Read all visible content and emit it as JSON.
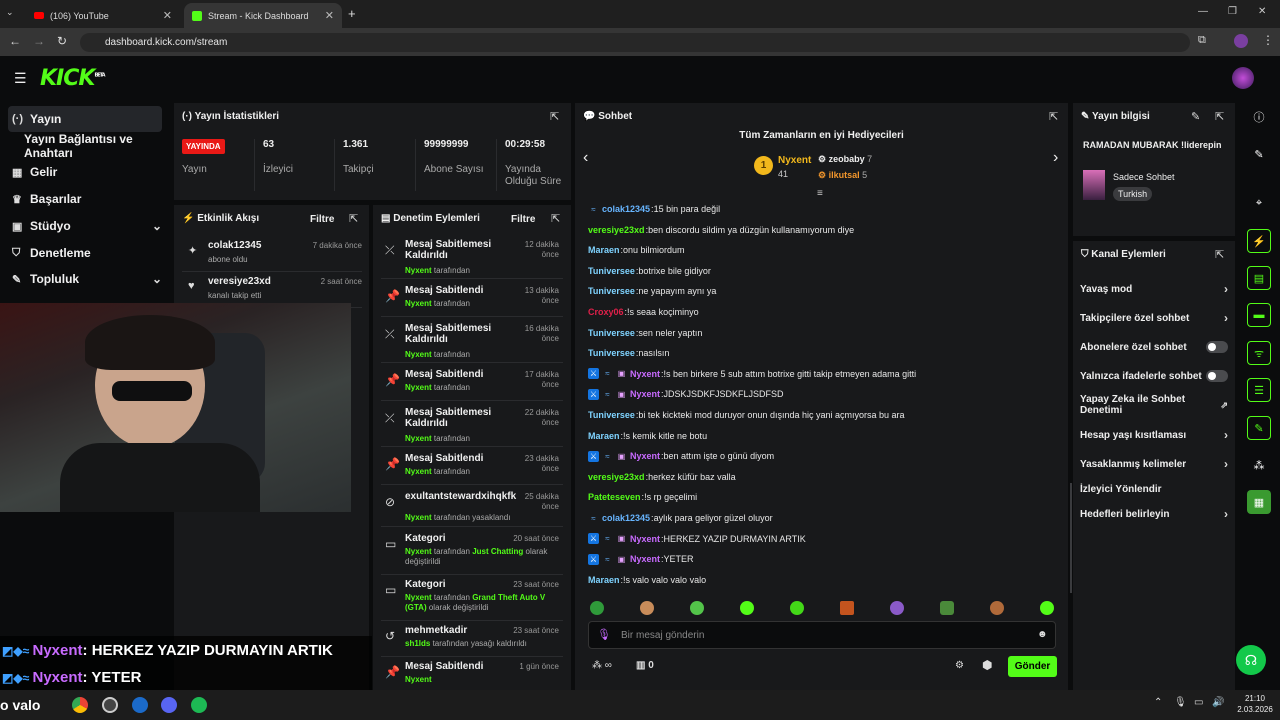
{
  "browser": {
    "tabs": [
      {
        "label": "(106) YouTube"
      },
      {
        "label": "Stream - Kick Dashboard"
      }
    ],
    "url": "dashboard.kick.com/stream"
  },
  "brand": {
    "logo": "KICK",
    "beta": "BETA"
  },
  "sidebar": {
    "items": [
      {
        "label": "Yayın"
      },
      {
        "label": "Yayın Bağlantısı ve Anahtarı"
      },
      {
        "label": "Gelir"
      },
      {
        "label": "Başarılar"
      },
      {
        "label": "Stüdyo"
      },
      {
        "label": "Denetleme"
      },
      {
        "label": "Topluluk"
      }
    ]
  },
  "stats": {
    "title": "Yayın İstatistikleri",
    "live": "YAYINDA",
    "live_label": "Yayın",
    "items": [
      {
        "value": "63",
        "label": "İzleyici"
      },
      {
        "value": "1.361",
        "label": "Takipçi"
      },
      {
        "value": "99999999",
        "label": "Abone Sayısı"
      },
      {
        "value": "00:29:58",
        "label": "Yayında Olduğu Süre"
      }
    ]
  },
  "activity": {
    "title": "Etkinlik Akışı",
    "filter": "Filtre",
    "events": [
      {
        "name": "colak12345",
        "sub": "abone oldu",
        "time": "7 dakika önce"
      },
      {
        "name": "veresiye23xd",
        "sub": "kanalı takip etti",
        "time": "2 saat önce"
      }
    ]
  },
  "modlog": {
    "title": "Denetim Eylemleri",
    "filter": "Filtre",
    "items": [
      {
        "title": "Mesaj Sabitlemesi Kaldırıldı",
        "user": "Nyxent",
        "rest": "tarafından",
        "time": "12 dakika önce"
      },
      {
        "title": "Mesaj Sabitlendi",
        "user": "Nyxent",
        "rest": "tarafından",
        "time": "13 dakika önce"
      },
      {
        "title": "Mesaj Sabitlemesi Kaldırıldı",
        "user": "Nyxent",
        "rest": "tarafından",
        "time": "16 dakika önce"
      },
      {
        "title": "Mesaj Sabitlendi",
        "user": "Nyxent",
        "rest": "tarafından",
        "time": "17 dakika önce"
      },
      {
        "title": "Mesaj Sabitlemesi Kaldırıldı",
        "user": "Nyxent",
        "rest": "tarafından",
        "time": "22 dakika önce"
      },
      {
        "title": "Mesaj Sabitlendi",
        "user": "Nyxent",
        "rest": "tarafından",
        "time": "23 dakika önce"
      },
      {
        "title": "exultantstewardxihqkfk",
        "user": "Nyxent",
        "rest": "tarafından yasaklandı",
        "time": "25 dakika önce"
      },
      {
        "title": "Kategori",
        "user": "Nyxent",
        "rest": "tarafından",
        "extra": "Just Chatting",
        "rest2": "olarak değiştirildi",
        "time": "20 saat önce"
      },
      {
        "title": "Kategori",
        "user": "Nyxent",
        "rest": "tarafından",
        "extra": "Grand Theft Auto V (GTA)",
        "rest2": "olarak değiştirildi",
        "time": "23 saat önce"
      },
      {
        "title": "mehmetkadir",
        "user": "sh1lds",
        "rest": "tarafından yasağı kaldırıldı",
        "time": "23 saat önce"
      },
      {
        "title": "Mesaj Sabitlendi",
        "user": "Nyxent",
        "rest": "",
        "time": "1 gün önce"
      }
    ]
  },
  "chat": {
    "title": "Sohbet",
    "top_title": "Tüm Zamanların en iyi Hediyecileri",
    "top": [
      {
        "rank": "1",
        "name": "Nyxent",
        "amount": "41"
      },
      {
        "name": "zeobaby",
        "amount": "7"
      },
      {
        "name": "ilkutsal",
        "amount": "5"
      }
    ],
    "messages": [
      {
        "user": "colak12345",
        "text": "15 bin para değil",
        "color": "#67b5ff",
        "badges": "v"
      },
      {
        "user": "veresiye23xd",
        "text": "ben discordu sildim ya düzgün kullanamıyorum diye",
        "color": "#53fc18",
        "badges": ""
      },
      {
        "user": "Maraen",
        "text": "onu bilmiordum",
        "color": "#7fd3ff",
        "badges": ""
      },
      {
        "user": "Tuniversee",
        "text": "botrixe bile gidiyor",
        "color": "#7fd3ff",
        "badges": ""
      },
      {
        "user": "Tuniversee",
        "text": "ne yapayım aynı ya",
        "color": "#7fd3ff",
        "badges": ""
      },
      {
        "user": "Croxy06",
        "text": "!s seaa koçiminyo",
        "color": "#e0204a",
        "badges": ""
      },
      {
        "user": "Tuniversee",
        "text": "sen neler yaptın",
        "color": "#7fd3ff",
        "badges": ""
      },
      {
        "user": "Tuniversee",
        "text": "nasılsın",
        "color": "#7fd3ff",
        "badges": ""
      },
      {
        "user": "Nyxent",
        "text": "!s ben birkere 5 sub attım botrixe gitti takip etmeyen adama gitti",
        "color": "#c86bff",
        "badges": "msv"
      },
      {
        "user": "Nyxent",
        "text": "JDSKJSDKFJSDKFLJSDFSD",
        "color": "#c86bff",
        "badges": "msv"
      },
      {
        "user": "Tuniversee",
        "text": "bi tek kickteki mod duruyor onun dışında hiç yani açmıyorsa bu ara",
        "color": "#7fd3ff",
        "badges": ""
      },
      {
        "user": "Maraen",
        "text": "!s kemik kitle ne botu",
        "color": "#7fd3ff",
        "badges": ""
      },
      {
        "user": "Nyxent",
        "text": "ben attım işte o günü diyom",
        "color": "#c86bff",
        "badges": "msv"
      },
      {
        "user": "veresiye23xd",
        "text": "herkez küfür baz valla",
        "color": "#53fc18",
        "badges": ""
      },
      {
        "user": "Pateteseven",
        "text": "!s rp geçelimi",
        "color": "#53fc18",
        "badges": ""
      },
      {
        "user": "colak12345",
        "text": "aylık para geliyor güzel oluyor",
        "color": "#67b5ff",
        "badges": "v"
      },
      {
        "user": "Nyxent",
        "text": "HERKEZ YAZIP DURMAYIN ARTIK",
        "color": "#c86bff",
        "badges": "msv"
      },
      {
        "user": "Nyxent",
        "text": "YETER",
        "color": "#c86bff",
        "badges": "msv"
      },
      {
        "user": "Maraen",
        "text": "!s valo valo valo valo",
        "color": "#7fd3ff",
        "badges": ""
      }
    ],
    "placeholder": "Bir mesaj gönderin",
    "points": "0",
    "send": "Gönder"
  },
  "streaminfo": {
    "title": "Yayın bilgisi",
    "stream_title": "RAMADAN MUBARAK !liderepin",
    "category": "Sadece Sohbet",
    "tag": "Turkish"
  },
  "actions": {
    "title": "Kanal Eylemleri",
    "items": [
      {
        "label": "Yavaş mod",
        "type": "chevron"
      },
      {
        "label": "Takipçilere özel sohbet",
        "type": "chevron"
      },
      {
        "label": "Abonelere özel sohbet",
        "type": "toggle"
      },
      {
        "label": "Yalnızca ifadelerle sohbet",
        "type": "toggle"
      },
      {
        "label": "Yapay Zeka ile Sohbet Denetimi",
        "type": "external"
      },
      {
        "label": "Hesap yaşı kısıtlaması",
        "type": "chevron"
      },
      {
        "label": "Yasaklanmış kelimeler",
        "type": "chevron"
      },
      {
        "label": "İzleyici Yönlendir",
        "type": "none"
      },
      {
        "label": "Hedefleri belirleyin",
        "type": "chevron"
      }
    ]
  },
  "overlay": {
    "lines": [
      {
        "user": "Nyxent",
        "text": ": HERKEZ YAZIP DURMAYIN ARTIK"
      },
      {
        "user": "Nyxent",
        "text": ": YETER"
      }
    ],
    "partial": "o valo"
  },
  "taskbar": {
    "time": "21:10",
    "date": "2.03.2026"
  },
  "colors": {
    "accent": "#53fc18",
    "panel": "#18191b",
    "bg": "#0b0c0d",
    "live": "#e91916"
  }
}
